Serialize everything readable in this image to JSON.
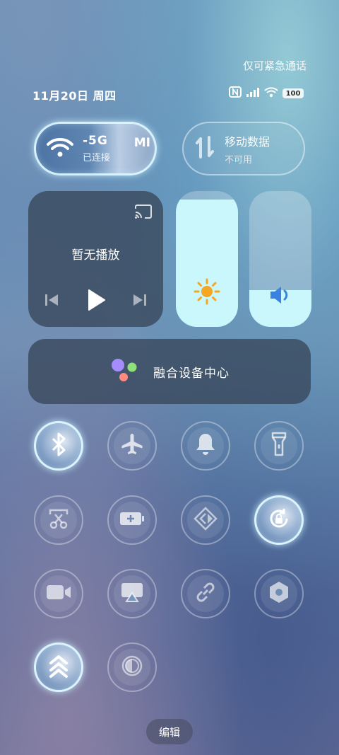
{
  "status": {
    "emergency_text": "仅可紧急通话",
    "date": "11月20日 周四",
    "battery": "100"
  },
  "wifi": {
    "ssid_fragment": "-5G",
    "ssid_suffix": "MI",
    "status": "已连接",
    "active": true
  },
  "mobile_data": {
    "label": "移动数据",
    "status": "不可用",
    "active": false
  },
  "media": {
    "title": "暂无播放"
  },
  "brightness": {
    "level": 0.94
  },
  "volume": {
    "level": 0.27
  },
  "fusion": {
    "label": "融合设备中心"
  },
  "tiles": [
    {
      "icon": "bluetooth-icon",
      "active": true
    },
    {
      "icon": "airplane-icon",
      "active": false
    },
    {
      "icon": "bell-icon",
      "active": false
    },
    {
      "icon": "flashlight-icon",
      "active": false
    },
    {
      "icon": "screenshot-icon",
      "active": false
    },
    {
      "icon": "battery-saver-icon",
      "active": false
    },
    {
      "icon": "nearby-share-icon",
      "active": false
    },
    {
      "icon": "rotation-lock-icon",
      "active": true
    },
    {
      "icon": "video-icon",
      "active": false
    },
    {
      "icon": "screen-cast-icon",
      "active": false
    },
    {
      "icon": "link-icon",
      "active": false
    },
    {
      "icon": "settings-hex-icon",
      "active": false
    },
    {
      "icon": "upload-speed-icon",
      "active": true
    },
    {
      "icon": "dark-mode-icon",
      "active": false
    }
  ],
  "colors": {
    "slider_fill": "#c9f7fb",
    "sun": "#f5a623",
    "speaker": "#3a82e0",
    "dot_purple": "#a58cff",
    "dot_green": "#8fe07a",
    "dot_red": "#ff8a80"
  },
  "edit": {
    "label": "编辑"
  }
}
